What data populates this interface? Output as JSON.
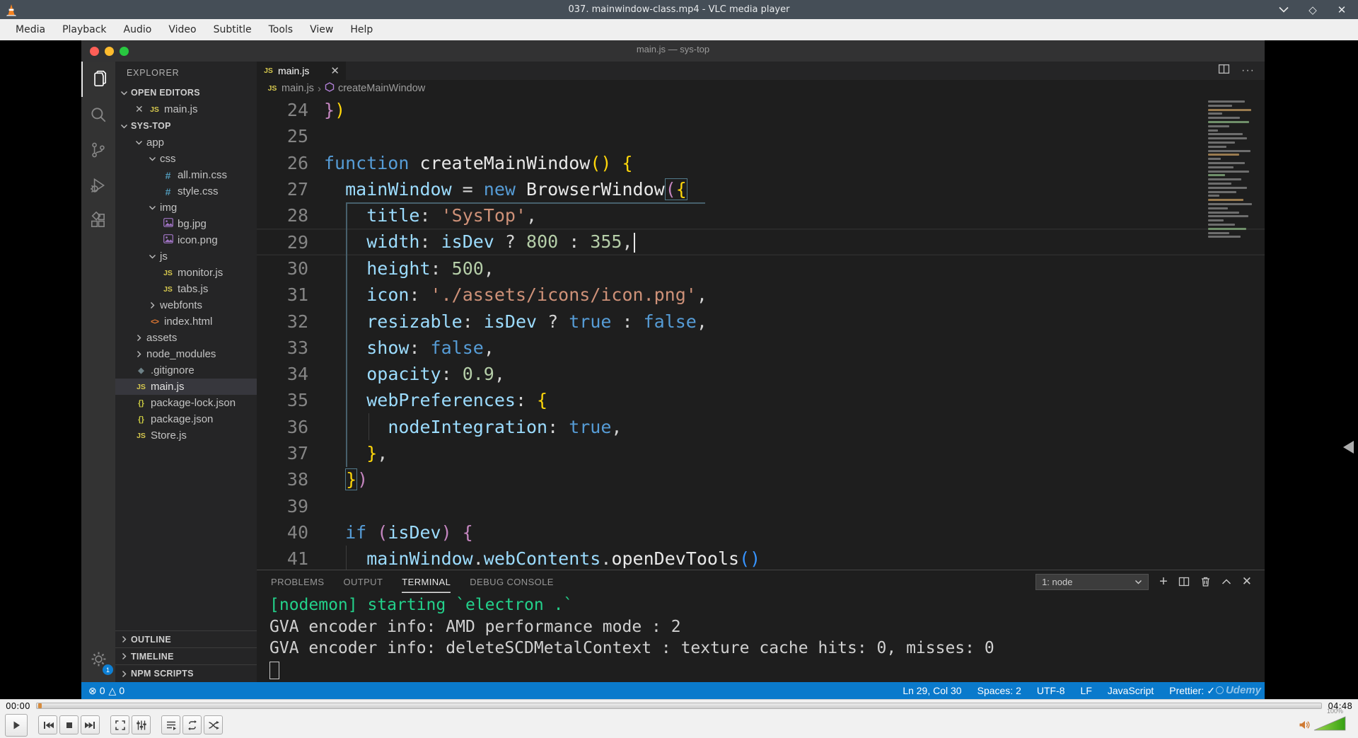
{
  "vlc": {
    "title": "037. mainwindow-class.mp4 - VLC media player",
    "menu": [
      "Media",
      "Playback",
      "Audio",
      "Video",
      "Subtitle",
      "Tools",
      "View",
      "Help"
    ],
    "time_elapsed": "00:00",
    "time_total": "04:48",
    "volume": "100%"
  },
  "vscode": {
    "window_title": "main.js — sys-top",
    "explorer": {
      "title": "EXPLORER",
      "open_editors_label": "OPEN EDITORS",
      "open_editor_file": "main.js",
      "project_label": "SYS-TOP",
      "tree": [
        {
          "label": "app",
          "level": 1,
          "chev": "down"
        },
        {
          "label": "css",
          "level": 2,
          "chev": "down"
        },
        {
          "label": "all.min.css",
          "level": 3,
          "icon": "hash"
        },
        {
          "label": "style.css",
          "level": 3,
          "icon": "hash"
        },
        {
          "label": "img",
          "level": 2,
          "chev": "down"
        },
        {
          "label": "bg.jpg",
          "level": 3,
          "icon": "image"
        },
        {
          "label": "icon.png",
          "level": 3,
          "icon": "image"
        },
        {
          "label": "js",
          "level": 2,
          "chev": "down"
        },
        {
          "label": "monitor.js",
          "level": 3,
          "icon": "js"
        },
        {
          "label": "tabs.js",
          "level": 3,
          "icon": "js"
        },
        {
          "label": "webfonts",
          "level": 2,
          "chev": "right"
        },
        {
          "label": "index.html",
          "level": 2,
          "icon": "html"
        },
        {
          "label": "assets",
          "level": 1,
          "chev": "right"
        },
        {
          "label": "node_modules",
          "level": 1,
          "chev": "right"
        },
        {
          "label": ".gitignore",
          "level": 1,
          "icon": "git"
        },
        {
          "label": "main.js",
          "level": 1,
          "icon": "js",
          "selected": true
        },
        {
          "label": "package-lock.json",
          "level": 1,
          "icon": "json"
        },
        {
          "label": "package.json",
          "level": 1,
          "icon": "json"
        },
        {
          "label": "Store.js",
          "level": 1,
          "icon": "js"
        }
      ],
      "bottom_sections": [
        "OUTLINE",
        "TIMELINE",
        "NPM SCRIPTS"
      ]
    },
    "tab_label": "main.js",
    "breadcrumb": {
      "file": "main.js",
      "symbol": "createMainWindow"
    },
    "code": {
      "lines": [
        {
          "n": 24,
          "segs": [
            [
              "m",
              "}"
            ],
            [
              "g",
              ")"
            ]
          ]
        },
        {
          "n": 25,
          "segs": []
        },
        {
          "n": 26,
          "segs": [
            [
              "k",
              "function"
            ],
            [
              "w",
              " "
            ],
            [
              "fn",
              "createMainWindow"
            ],
            [
              "g",
              "("
            ],
            [
              "g",
              ")"
            ],
            [
              "w",
              " "
            ],
            [
              "g",
              "{"
            ]
          ]
        },
        {
          "n": 27,
          "segs": [
            [
              "w",
              "  "
            ],
            [
              "v",
              "mainWindow"
            ],
            [
              "w",
              " = "
            ],
            [
              "k",
              "new"
            ],
            [
              "w",
              " "
            ],
            [
              "fn",
              "BrowserWindow"
            ],
            [
              "m bxl",
              "("
            ],
            [
              "g bxr",
              "{"
            ]
          ]
        },
        {
          "n": 28,
          "segs": [
            [
              "w",
              "    "
            ],
            [
              "v",
              "title"
            ],
            [
              "w",
              ": "
            ],
            [
              "s",
              "'SysTop'"
            ],
            [
              "w",
              ","
            ]
          ]
        },
        {
          "n": 29,
          "cursor": true,
          "segs": [
            [
              "w",
              "    "
            ],
            [
              "v",
              "width"
            ],
            [
              "w",
              ": "
            ],
            [
              "v",
              "isDev"
            ],
            [
              "w",
              " ? "
            ],
            [
              "n",
              "800"
            ],
            [
              "w",
              " : "
            ],
            [
              "n",
              "355"
            ],
            [
              "w",
              ","
            ]
          ]
        },
        {
          "n": 30,
          "segs": [
            [
              "w",
              "    "
            ],
            [
              "v",
              "height"
            ],
            [
              "w",
              ": "
            ],
            [
              "n",
              "500"
            ],
            [
              "w",
              ","
            ]
          ]
        },
        {
          "n": 31,
          "segs": [
            [
              "w",
              "    "
            ],
            [
              "v",
              "icon"
            ],
            [
              "w",
              ": "
            ],
            [
              "s",
              "'./assets/icons/icon.png'"
            ],
            [
              "w",
              ","
            ]
          ]
        },
        {
          "n": 32,
          "segs": [
            [
              "w",
              "    "
            ],
            [
              "v",
              "resizable"
            ],
            [
              "w",
              ": "
            ],
            [
              "v",
              "isDev"
            ],
            [
              "w",
              " ? "
            ],
            [
              "k",
              "true"
            ],
            [
              "w",
              " : "
            ],
            [
              "k",
              "false"
            ],
            [
              "w",
              ","
            ]
          ]
        },
        {
          "n": 33,
          "segs": [
            [
              "w",
              "    "
            ],
            [
              "v",
              "show"
            ],
            [
              "w",
              ": "
            ],
            [
              "k",
              "false"
            ],
            [
              "w",
              ","
            ]
          ]
        },
        {
          "n": 34,
          "segs": [
            [
              "w",
              "    "
            ],
            [
              "v",
              "opacity"
            ],
            [
              "w",
              ": "
            ],
            [
              "n",
              "0.9"
            ],
            [
              "w",
              ","
            ]
          ]
        },
        {
          "n": 35,
          "segs": [
            [
              "w",
              "    "
            ],
            [
              "v",
              "webPreferences"
            ],
            [
              "w",
              ": "
            ],
            [
              "g",
              "{"
            ]
          ]
        },
        {
          "n": 36,
          "segs": [
            [
              "w",
              "      "
            ],
            [
              "v",
              "nodeIntegration"
            ],
            [
              "w",
              ": "
            ],
            [
              "k",
              "true"
            ],
            [
              "w",
              ","
            ]
          ]
        },
        {
          "n": 37,
          "segs": [
            [
              "w",
              "    "
            ],
            [
              "g",
              "}"
            ],
            [
              "w",
              ","
            ]
          ]
        },
        {
          "n": 38,
          "segs": [
            [
              "w",
              "  "
            ],
            [
              "g bx",
              "}"
            ],
            [
              "m",
              ")"
            ]
          ]
        },
        {
          "n": 39,
          "segs": []
        },
        {
          "n": 40,
          "segs": [
            [
              "w",
              "  "
            ],
            [
              "k",
              "if"
            ],
            [
              "w",
              " "
            ],
            [
              "m",
              "("
            ],
            [
              "v",
              "isDev"
            ],
            [
              "m",
              ")"
            ],
            [
              "w",
              " "
            ],
            [
              "m",
              "{"
            ]
          ]
        },
        {
          "n": 41,
          "segs": [
            [
              "w",
              "    "
            ],
            [
              "v",
              "mainWindow"
            ],
            [
              "w",
              "."
            ],
            [
              "v",
              "webContents"
            ],
            [
              "w",
              "."
            ],
            [
              "fn",
              "openDevTools"
            ],
            [
              "b",
              "("
            ],
            [
              "b",
              ")"
            ]
          ]
        }
      ]
    },
    "panel": {
      "tabs": [
        "PROBLEMS",
        "OUTPUT",
        "TERMINAL",
        "DEBUG CONSOLE"
      ],
      "active_tab": "TERMINAL",
      "shell_select": "1: node",
      "terminal_lines": [
        {
          "c": "g",
          "t": "[nodemon] starting `electron .`"
        },
        {
          "c": "w",
          "t": "GVA encoder info: AMD performance mode : 2"
        },
        {
          "c": "w",
          "t": "GVA encoder info: deleteSCDMetalContext : texture cache hits: 0, misses: 0"
        }
      ]
    },
    "status": {
      "errors": "0",
      "warnings": "0",
      "cursor_pos": "Ln 29, Col 30",
      "indent": "Spaces: 2",
      "encoding": "UTF-8",
      "eol": "LF",
      "language": "JavaScript",
      "formatter": "Prettier:",
      "formatter_check": "✓",
      "watermark": "Udemy"
    }
  }
}
